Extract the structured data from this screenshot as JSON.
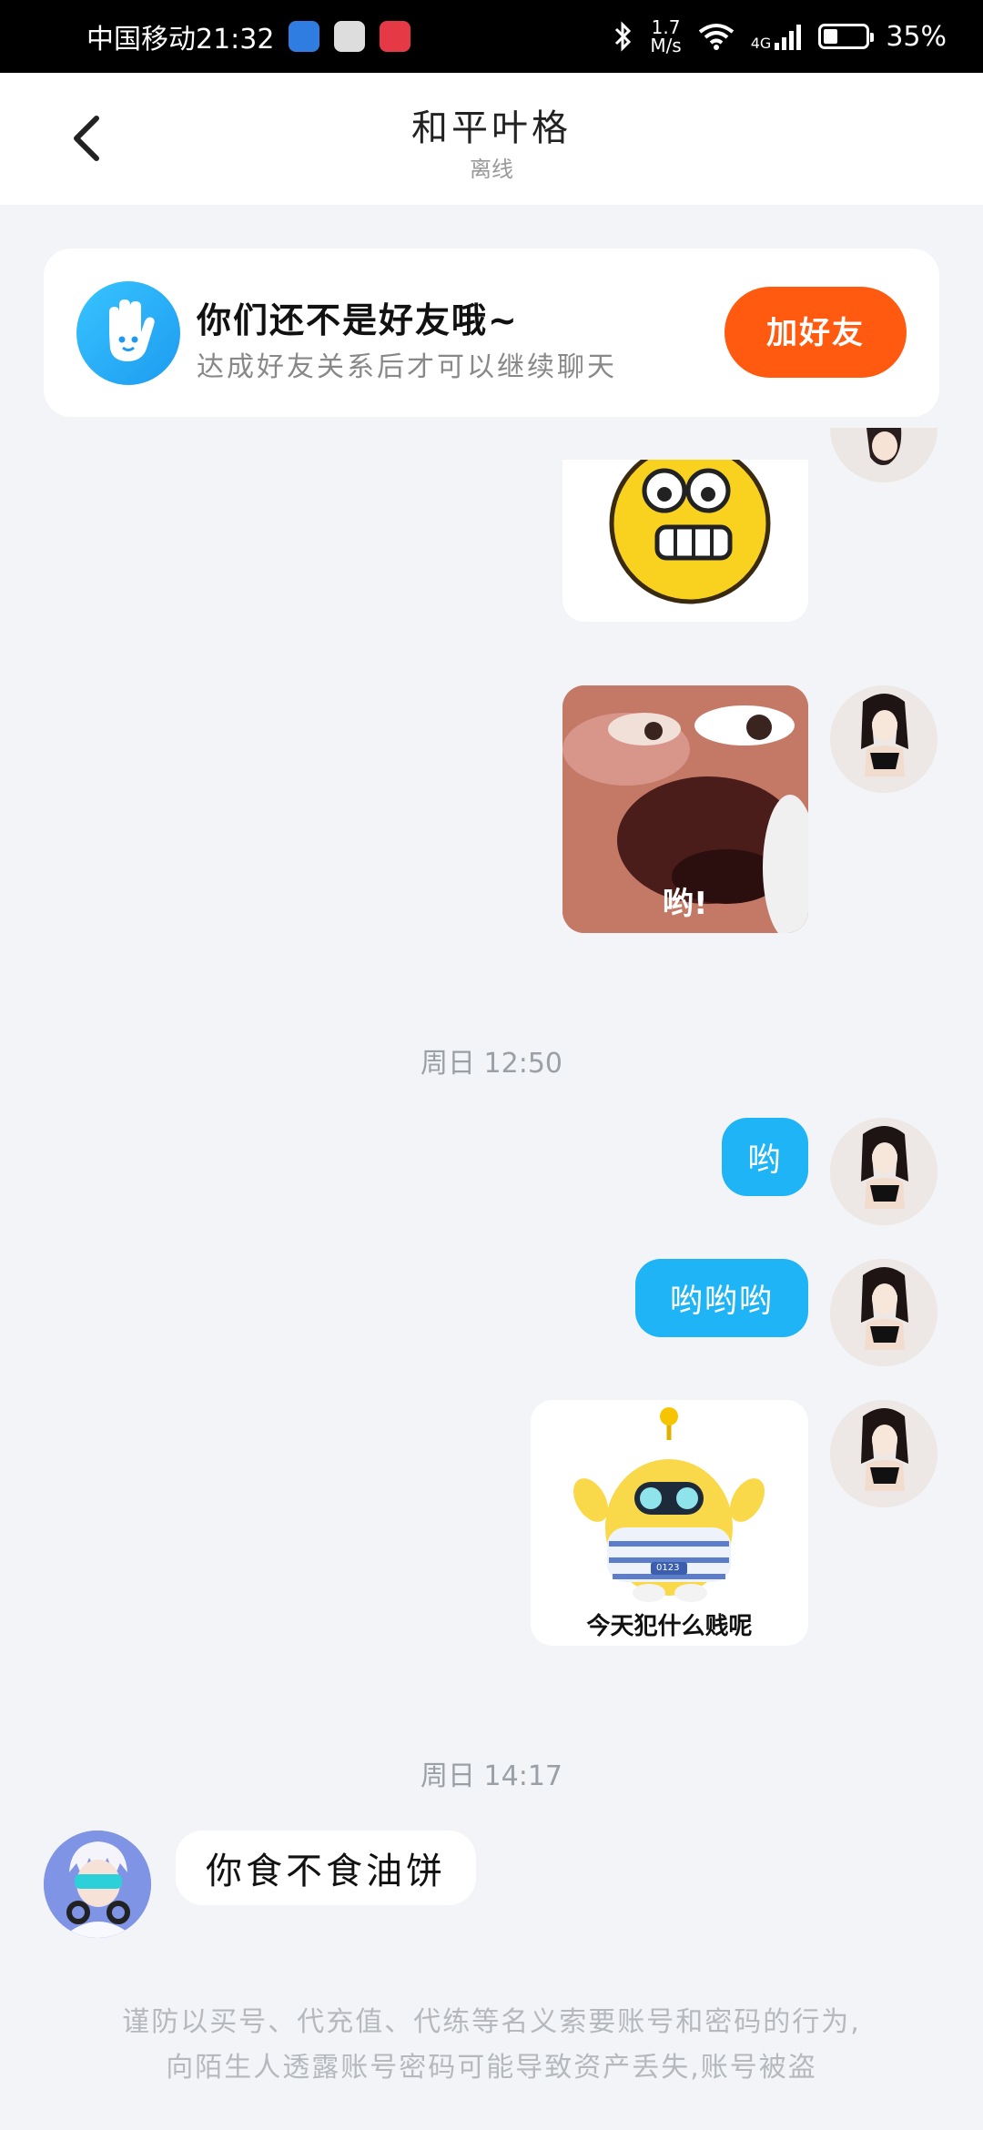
{
  "status_bar": {
    "carrier_time": "中国移动21:32",
    "net_speed_value": "1.7",
    "net_speed_unit": "M/s",
    "network_type": "4G",
    "battery": "35%",
    "battery_level": 0.35
  },
  "header": {
    "title": "和平叶格",
    "status": "离线"
  },
  "banner": {
    "title": "你们还不是好友哦~",
    "subtitle": "达成好友关系后才可以继续聊天",
    "button": "加好友"
  },
  "messages": {
    "sticker2_caption": "哟!",
    "time1": "周日 12:50",
    "msg1": "哟",
    "msg2": "哟哟哟",
    "sticker3_caption": "今天犯什么贱呢",
    "sticker3_badge": "0123",
    "time2": "周日 14:17",
    "msg_received": "你食不食油饼"
  },
  "footer": {
    "line1": "谨防以买号、代充值、代练等名义索要账号和密码的行为,",
    "line2": "向陌生人透露账号密码可能导致资产丢失,账号被盗"
  },
  "colors": {
    "accent_blue": "#1eb4f5",
    "button_orange": "#ff5a0f",
    "background": "#f2f4f7"
  }
}
